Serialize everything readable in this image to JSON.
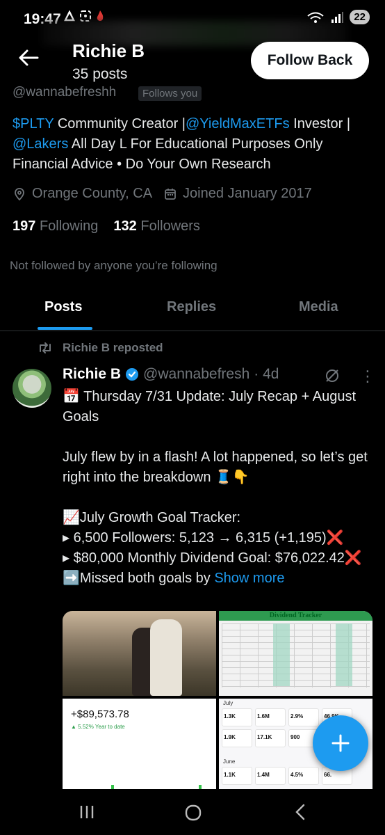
{
  "status_bar": {
    "time": "19:47",
    "battery": "22"
  },
  "header": {
    "name": "Richie B",
    "posts_count": "35 posts",
    "follow_back_label": "Follow Back"
  },
  "profile": {
    "handle": "@wannabefreshh",
    "follows_you": "Follows you",
    "bio": {
      "part1": "$PLTY",
      "part2": " Community Creator |",
      "part3": "@YieldMaxETFs",
      "part4": " Investor | ",
      "part5": "@Lakers",
      "part6": " All Day L For Educational Purposes Only Financial Advice • Do Your Own Research"
    },
    "location": "Orange County, CA",
    "joined": "Joined January 2017",
    "following_count": "197",
    "following_label": "Following",
    "followers_count": "132",
    "followers_label": "Followers",
    "not_followed": "Not followed by anyone you’re following"
  },
  "tabs": [
    {
      "label": "Posts"
    },
    {
      "label": "Replies"
    },
    {
      "label": "Media"
    }
  ],
  "post": {
    "reposted_by": "Richie B reposted",
    "author_name": "Richie B",
    "author_handle": "@wannabefresh",
    "time": "· 4d",
    "more": "⋮",
    "text": "📅 Thursday 7/31 Update: July Recap + August Goals\n\nJuly flew by in a flash! A lot happened, so let’s get right into the breakdown 🧵👇\n\n📈July Growth Goal Tracker:\n▸ 6,500 Followers: 5,123 → 6,315 (+1,195)❌\n▸ $80,000 Monthly Dividend Goal: $76,022.42❌\n➡️Missed both goals by ",
    "show_more": "Show more",
    "media": {
      "tracker_title": "Dividend Tracker",
      "portfolio_value": "+$89,573.78",
      "portfolio_change": "▲ 5.52% Year to date",
      "stats_labels": [
        "July",
        "June"
      ]
    }
  },
  "colors": {
    "accent": "#1d9bf0",
    "background": "#000000",
    "muted": "#71767b"
  }
}
